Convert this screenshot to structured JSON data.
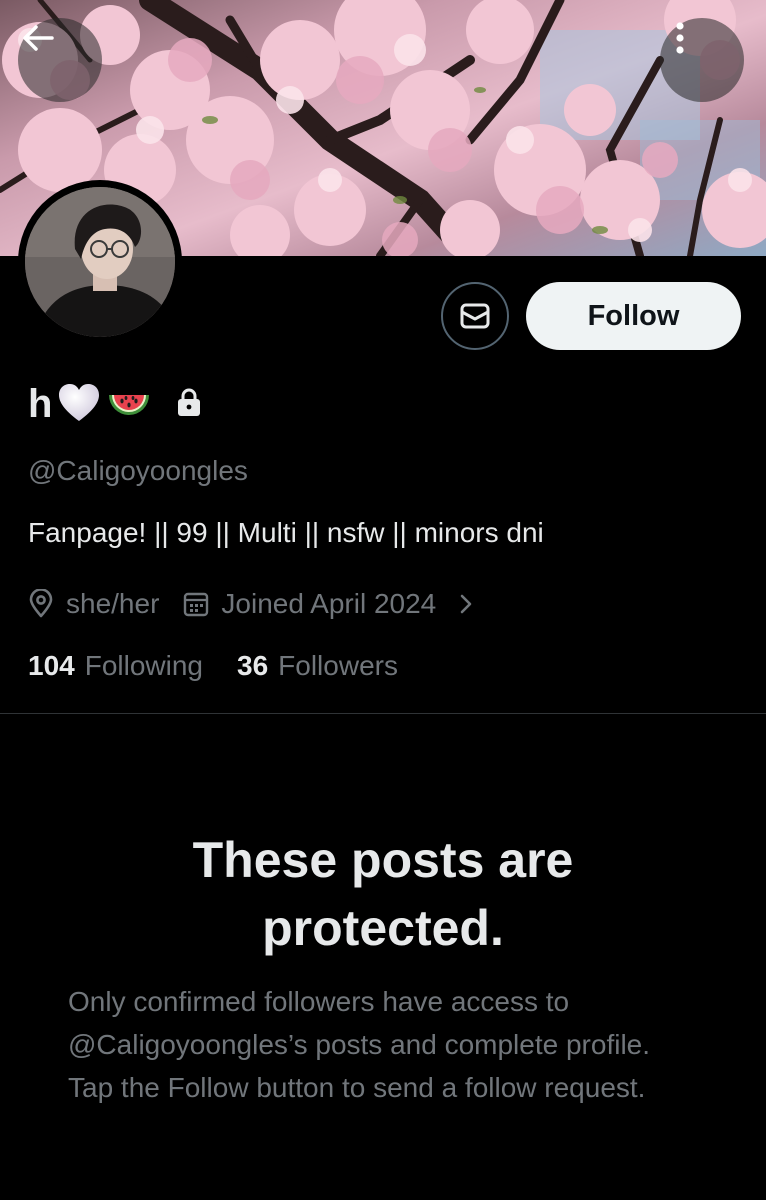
{
  "header": {
    "back_icon": "arrow-left-icon",
    "more_icon": "more-vertical-icon",
    "banner_image": "cherry-blossom-banner"
  },
  "profile": {
    "display_name": "h",
    "name_emojis": [
      "white-heart-emoji",
      "watermelon-emoji"
    ],
    "protected_icon": "lock-icon",
    "handle": "@Caligoyoongles",
    "bio": "Fanpage! || 99 || Multi || nsfw || minors dni",
    "location": "she/her",
    "location_icon": "location-pin-icon",
    "joined": "Joined April 2024",
    "joined_icon": "calendar-icon",
    "following_count": "104",
    "following_label": "Following",
    "followers_count": "36",
    "followers_label": "Followers"
  },
  "actions": {
    "message_icon": "mail-icon",
    "follow_label": "Follow"
  },
  "protected_notice": {
    "title": "These posts are protected.",
    "body": "Only confirmed followers have access to @Caligoyoongles’s posts and complete profile. Tap the Follow button to send a follow request."
  },
  "colors": {
    "background": "#000000",
    "primary_text": "#e7e9ea",
    "secondary_text": "#71767b",
    "follow_button_bg": "#eff3f4",
    "follow_button_text": "#0f1419",
    "divider": "#2f3336"
  }
}
